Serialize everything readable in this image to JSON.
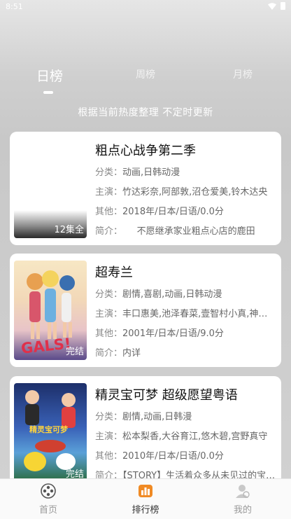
{
  "status": {
    "time": "8:51"
  },
  "tabs": [
    {
      "label": "日榜"
    },
    {
      "label": "周榜"
    },
    {
      "label": "月榜"
    }
  ],
  "subtitle": "根据当前热度整理 不定时更新",
  "items": [
    {
      "title": "粗点心战争第二季",
      "genre_k": "分类：",
      "genre_v": "动画,日韩动漫",
      "cast_k": "主演：",
      "cast_v": "竹达彩奈,阿部敦,沼仓爱美,铃木达央",
      "other_k": "其他：",
      "other_v": "2018年/日本/日语/0.0分",
      "intro_k": "简介：",
      "intro_v": "     不愿继承家业粗点心店的鹿田",
      "badge": "12集全"
    },
    {
      "title": "超寿兰",
      "genre_k": "分类：",
      "genre_v": "剧情,喜剧,动画,日韩动漫",
      "cast_k": "主演：",
      "cast_v": "丰口惠美,池泽春菜,壹智村小真,神田朱未",
      "other_k": "其他：",
      "other_v": "2001年/日本/日语/9.0分",
      "intro_k": "简介：",
      "intro_v": "内详",
      "badge": "完结",
      "poster_text": "GALS!"
    },
    {
      "title": "精灵宝可梦 超级愿望粤语",
      "genre_k": "分类：",
      "genre_v": "剧情,动画,日韩漫",
      "cast_k": "主演：",
      "cast_v": "松本梨香,大谷育江,悠木碧,宫野真守",
      "other_k": "其他：",
      "other_v": "2010年/日本/日语/0.0分",
      "intro_k": "简介：",
      "intro_v": "【STORY】生活着众多从未见过的宝可梦",
      "badge": "完结",
      "poster_text": "精灵宝可梦"
    }
  ],
  "nav": [
    {
      "label": "首页",
      "icon": "film-reel-icon"
    },
    {
      "label": "排行榜",
      "icon": "ranking-icon"
    },
    {
      "label": "我的",
      "icon": "user-icon"
    }
  ],
  "colors": {
    "accent": "#f08a24",
    "card_bg": "#ffffff",
    "nav_active": "#333333",
    "nav_inactive": "#999999"
  }
}
